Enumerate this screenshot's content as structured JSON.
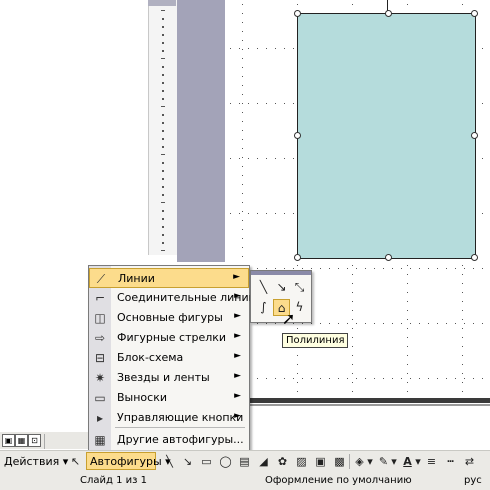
{
  "menu": {
    "items": [
      {
        "label": "Линии",
        "has_submenu": true,
        "icon": "lines-icon",
        "highlighted": true
      },
      {
        "label": "Соединительные линии",
        "has_submenu": true,
        "icon": "connectors-icon"
      },
      {
        "label": "Основные фигуры",
        "has_submenu": true,
        "icon": "basic-shapes-icon"
      },
      {
        "label": "Фигурные стрелки",
        "has_submenu": true,
        "icon": "block-arrows-icon"
      },
      {
        "label": "Блок-схема",
        "has_submenu": true,
        "icon": "flowchart-icon"
      },
      {
        "label": "Звезды и ленты",
        "has_submenu": true,
        "icon": "stars-banners-icon"
      },
      {
        "label": "Выноски",
        "has_submenu": true,
        "icon": "callouts-icon"
      },
      {
        "label": "Управляющие кнопки",
        "has_submenu": true,
        "icon": "action-buttons-icon"
      },
      {
        "label": "Другие автофигуры...",
        "has_submenu": false,
        "icon": "more-autoshapes-icon"
      }
    ],
    "submenu_arrow": "►"
  },
  "submenu": {
    "buttons": [
      "line-icon",
      "arrow-icon",
      "double-arrow-icon",
      "curve-icon",
      "freeform-icon",
      "scribble-icon"
    ],
    "selected": "freeform-icon"
  },
  "tooltip": {
    "text": "Полилиния"
  },
  "toolbar": {
    "actions_label": "Действия",
    "autoshapes_label": "Автофигуры",
    "dropdown_arrow": "▾"
  },
  "statusbar": {
    "slide": "Слайд 1 из 1",
    "design": "Оформление по умолчанию",
    "language": "рус"
  },
  "colors": {
    "shape_fill": "#b5dcdc",
    "highlight": "#fcdc8c",
    "toolbar_bg": "#ebeae6",
    "scroll_bar": "#a3a3b8"
  }
}
